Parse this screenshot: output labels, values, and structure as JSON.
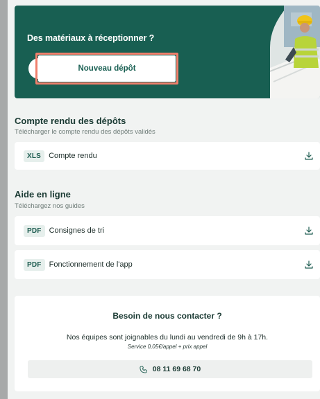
{
  "hero": {
    "title": "Des matériaux à réceptionner ?",
    "button_label": "Nouveau dépôt"
  },
  "reports": {
    "title": "Compte rendu des dépôts",
    "subtitle": "Télécharger le compte rendu des dépôts validés",
    "items": [
      {
        "badge": "XLS",
        "label": "Compte rendu",
        "icon": "download-icon"
      }
    ]
  },
  "help": {
    "title": "Aide en ligne",
    "subtitle": "Téléchargez nos guides",
    "items": [
      {
        "badge": "PDF",
        "label": "Consignes de tri",
        "icon": "download-icon"
      },
      {
        "badge": "PDF",
        "label": "Fonctionnement de l'app",
        "icon": "download-icon"
      }
    ]
  },
  "contact": {
    "title": "Besoin de nous contacter ?",
    "text": "Nos équipes sont joignables du lundi au vendredi de 9h à 17h.",
    "note": "Service 0,05€/appel + prix appel",
    "phone": "08 11 69 68 70",
    "phone_icon": "phone-icon"
  },
  "colors": {
    "primary": "#185f52",
    "highlight": "#f07f6c",
    "background": "#f1f3f2"
  }
}
